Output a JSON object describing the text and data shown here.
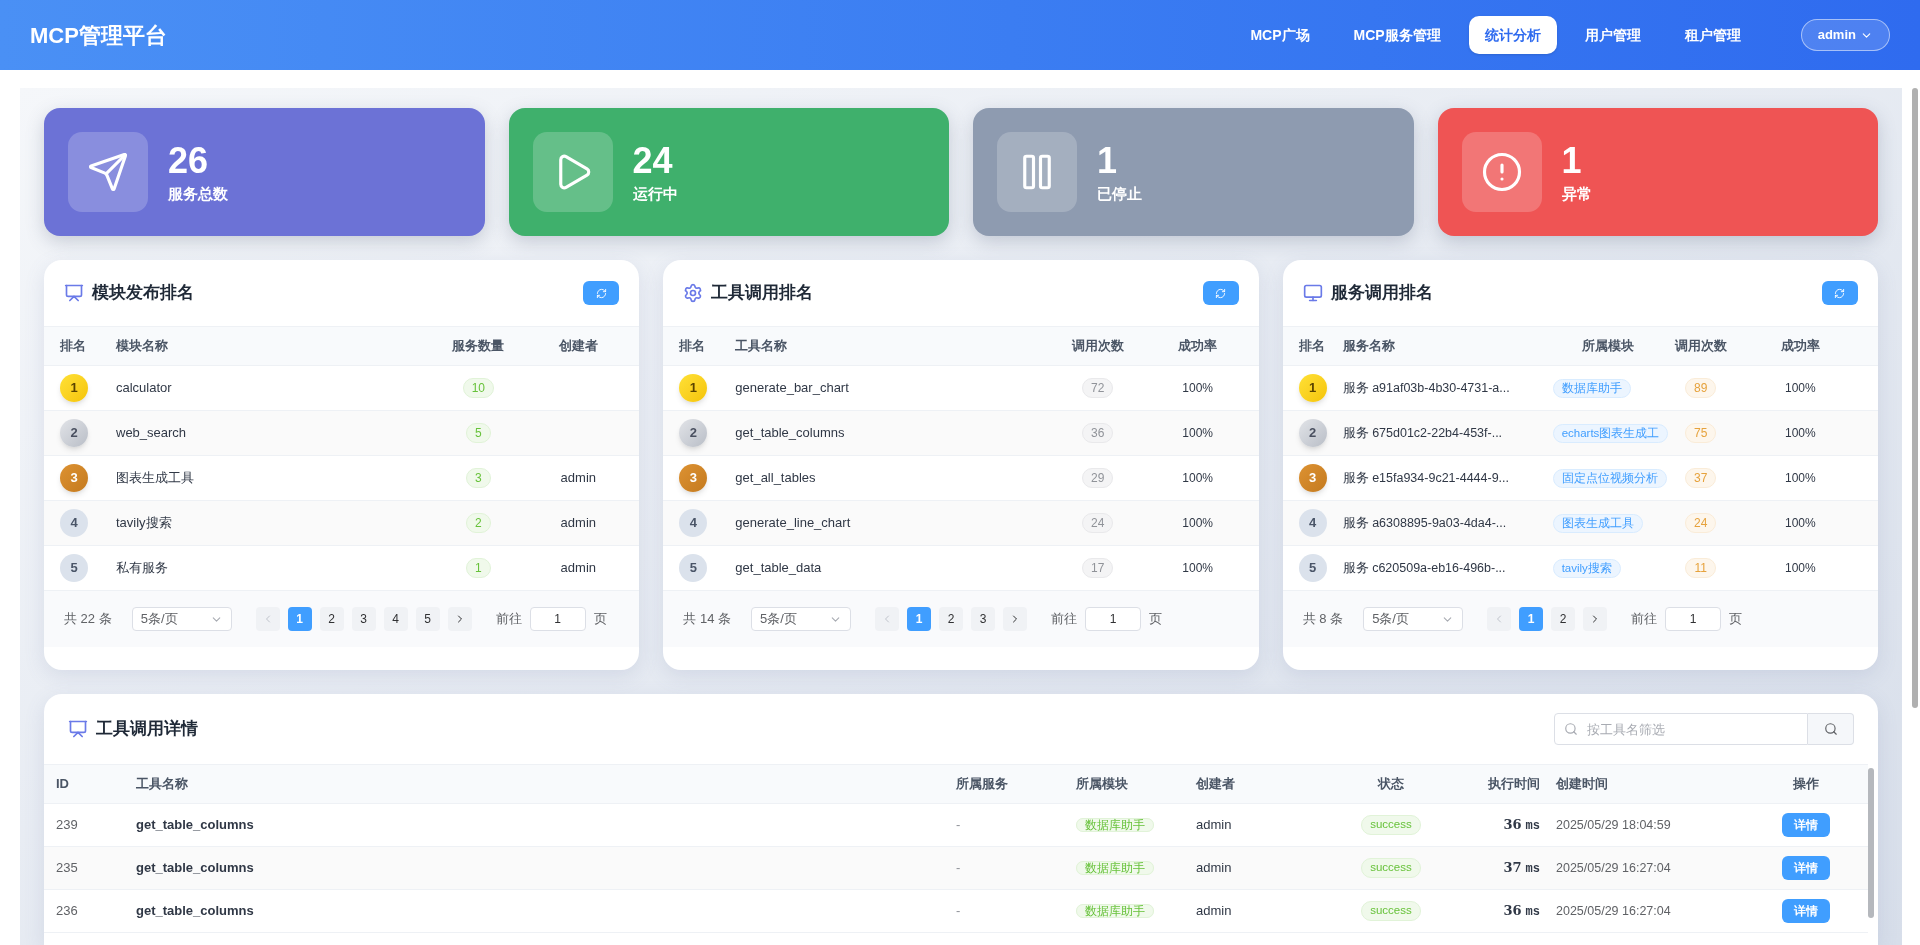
{
  "header": {
    "title": "MCP管理平台",
    "nav": [
      {
        "label": "MCP广场",
        "selected": false
      },
      {
        "label": "MCP服务管理",
        "selected": false
      },
      {
        "label": "统计分析",
        "selected": true
      },
      {
        "label": "用户管理",
        "selected": false
      },
      {
        "label": "租户管理",
        "selected": false
      }
    ],
    "user": "admin"
  },
  "stats": [
    {
      "value": "26",
      "label": "服务总数",
      "color": "#6c72d6"
    },
    {
      "value": "24",
      "label": "运行中",
      "color": "#3fb06c"
    },
    {
      "value": "1",
      "label": "已停止",
      "color": "#8e9bb0"
    },
    {
      "value": "1",
      "label": "异常",
      "color": "#ef5454"
    }
  ],
  "module_ranking": {
    "title": "模块发布排名",
    "columns": [
      "排名",
      "模块名称",
      "服务数量",
      "创建者"
    ],
    "rows": [
      {
        "rank": "1",
        "name": "calculator",
        "count": "10",
        "creator": ""
      },
      {
        "rank": "2",
        "name": "web_search",
        "count": "5",
        "creator": ""
      },
      {
        "rank": "3",
        "name": "图表生成工具",
        "count": "3",
        "creator": "admin"
      },
      {
        "rank": "4",
        "name": "tavily搜索",
        "count": "2",
        "creator": "admin"
      },
      {
        "rank": "5",
        "name": "私有服务",
        "count": "1",
        "creator": "admin"
      }
    ],
    "pagination": {
      "total": "共 22 条",
      "page_size": "5条/页",
      "prev_disabled": true,
      "pages": [
        {
          "label": "1",
          "selected": true
        },
        {
          "label": "2",
          "selected": false
        },
        {
          "label": "3",
          "selected": false
        },
        {
          "label": "4",
          "selected": false
        },
        {
          "label": "5",
          "selected": false
        }
      ],
      "goto_label": "前往",
      "goto_value": "1",
      "goto_suffix": "页"
    }
  },
  "tool_ranking": {
    "title": "工具调用排名",
    "columns": [
      "排名",
      "工具名称",
      "调用次数",
      "成功率"
    ],
    "rows": [
      {
        "rank": "1",
        "name": "generate_bar_chart",
        "count": "72",
        "rate": "100%"
      },
      {
        "rank": "2",
        "name": "get_table_columns",
        "count": "36",
        "rate": "100%"
      },
      {
        "rank": "3",
        "name": "get_all_tables",
        "count": "29",
        "rate": "100%"
      },
      {
        "rank": "4",
        "name": "generate_line_chart",
        "count": "24",
        "rate": "100%"
      },
      {
        "rank": "5",
        "name": "get_table_data",
        "count": "17",
        "rate": "100%"
      }
    ],
    "pagination": {
      "total": "共 14 条",
      "page_size": "5条/页",
      "prev_disabled": true,
      "pages": [
        {
          "label": "1",
          "selected": true
        },
        {
          "label": "2",
          "selected": false
        },
        {
          "label": "3",
          "selected": false
        }
      ],
      "goto_label": "前往",
      "goto_value": "1",
      "goto_suffix": "页"
    }
  },
  "service_ranking": {
    "title": "服务调用排名",
    "columns": [
      "排名",
      "服务名称",
      "所属模块",
      "调用次数",
      "成功率"
    ],
    "rows": [
      {
        "rank": "1",
        "name": "服务 a91af03b-4b30-4731-a...",
        "module": "数据库助手",
        "count": "89",
        "rate": "100%"
      },
      {
        "rank": "2",
        "name": "服务 675d01c2-22b4-453f-...",
        "module": "echarts图表生成工",
        "count": "75",
        "rate": "100%"
      },
      {
        "rank": "3",
        "name": "服务 e15fa934-9c21-4444-9...",
        "module": "固定点位视频分析",
        "count": "37",
        "rate": "100%"
      },
      {
        "rank": "4",
        "name": "服务 a6308895-9a03-4da4-...",
        "module": "图表生成工具",
        "count": "24",
        "rate": "100%"
      },
      {
        "rank": "5",
        "name": "服务 c620509a-eb16-496b-...",
        "module": "tavily搜索",
        "count": "11",
        "rate": "100%"
      }
    ],
    "pagination": {
      "total": "共 8 条",
      "page_size": "5条/页",
      "prev_disabled": true,
      "pages": [
        {
          "label": "1",
          "selected": true
        },
        {
          "label": "2",
          "selected": false
        }
      ],
      "goto_label": "前往",
      "goto_value": "1",
      "goto_suffix": "页"
    }
  },
  "tool_details": {
    "title": "工具调用详情",
    "search": {
      "placeholder": "按工具名筛选"
    },
    "columns": [
      "ID",
      "工具名称",
      "所属服务",
      "所属模块",
      "创建者",
      "状态",
      "执行时间",
      "创建时间",
      "操作"
    ],
    "rows": [
      {
        "id": "239",
        "tool": "get_table_columns",
        "service": "-",
        "module": "数据库助手",
        "creator": "admin",
        "status": "success",
        "duration": "36",
        "unit": "ms",
        "created": "2025/05/29 18:04:59",
        "action": "详情"
      },
      {
        "id": "235",
        "tool": "get_table_columns",
        "service": "-",
        "module": "数据库助手",
        "creator": "admin",
        "status": "success",
        "duration": "37",
        "unit": "ms",
        "created": "2025/05/29 16:27:04",
        "action": "详情"
      },
      {
        "id": "236",
        "tool": "get_table_columns",
        "service": "-",
        "module": "数据库助手",
        "creator": "admin",
        "status": "success",
        "duration": "36",
        "unit": "ms",
        "created": "2025/05/29 16:27:04",
        "action": "详情"
      }
    ]
  }
}
